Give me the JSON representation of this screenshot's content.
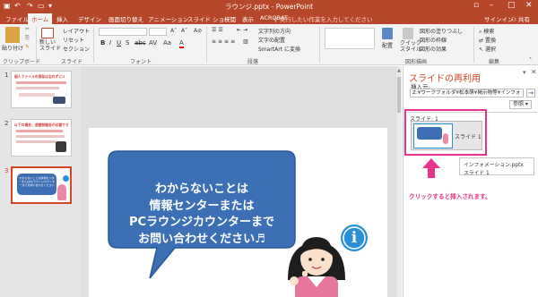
{
  "titlebar": {
    "title": "ラウンジ.pptx - PowerPoint",
    "colors": {
      "brand": "#b7472a",
      "accent": "#d24726",
      "highlight": "#e8338b"
    }
  },
  "tabs": [
    "ファイル",
    "ホーム",
    "挿入",
    "デザイン",
    "画面切り替え",
    "アニメーション",
    "スライド ショー",
    "校閲",
    "表示",
    "ACROBAT"
  ],
  "tell_me": "実行したい作業を入力してください",
  "user": {
    "signin": "サインイン",
    "share": "共有"
  },
  "ribbon": {
    "clipboard": {
      "paste": "貼り付け",
      "label": "クリップボード"
    },
    "slides": {
      "new_slide": "新しい\nスライド",
      "layout": "レイアウト",
      "reset": "リセット",
      "section": "セクション",
      "label": "スライド"
    },
    "font": {
      "label": "フォント"
    },
    "paragraph": {
      "text_direction": "文字列の方向",
      "align_text": "文字の配置",
      "smartart": "SmartArt に変換",
      "label": "段落"
    },
    "drawing": {
      "arrange": "配置",
      "quick_styles": "クイック\nスタイル",
      "fill": "図形の塗りつぶし",
      "outline": "図形の枠線",
      "effects": "図形の効果",
      "label": "図形描画"
    },
    "editing": {
      "find": "検索",
      "replace": "置換",
      "select": "選択",
      "label": "編集"
    }
  },
  "thumbnails": [
    {
      "num": "1",
      "title": "個人ファイルの保存は忘れずに!!",
      "selected": false
    },
    {
      "num": "2",
      "title": "以下の場合、退館前報告が必要です!",
      "selected": false
    },
    {
      "num": "3",
      "title": "わからないことは情報センターまたはPCラウンジカウンターまでお問い合わせください",
      "selected": true
    }
  ],
  "slide": {
    "bubble_lines": [
      "わからないことは",
      "情報センターまたは",
      "PCラウンジカウンターまで",
      "お問い合わせください♬"
    ],
    "info_symbol": "i"
  },
  "reuse": {
    "title": "スライドの再利用",
    "insert_from": "挿入元:",
    "path": "Z:¥ワークフォルダ¥松本萌¥掲示物等¥インフォ",
    "go": "→",
    "browse": "参照",
    "slides_label": "スライド:",
    "slides_count": "1",
    "item_label": "スライド 1",
    "tooltip_file": "インフォメーション.pptx",
    "tooltip_slide": "スライド 1",
    "note": "クリックすると挿入されます。"
  }
}
